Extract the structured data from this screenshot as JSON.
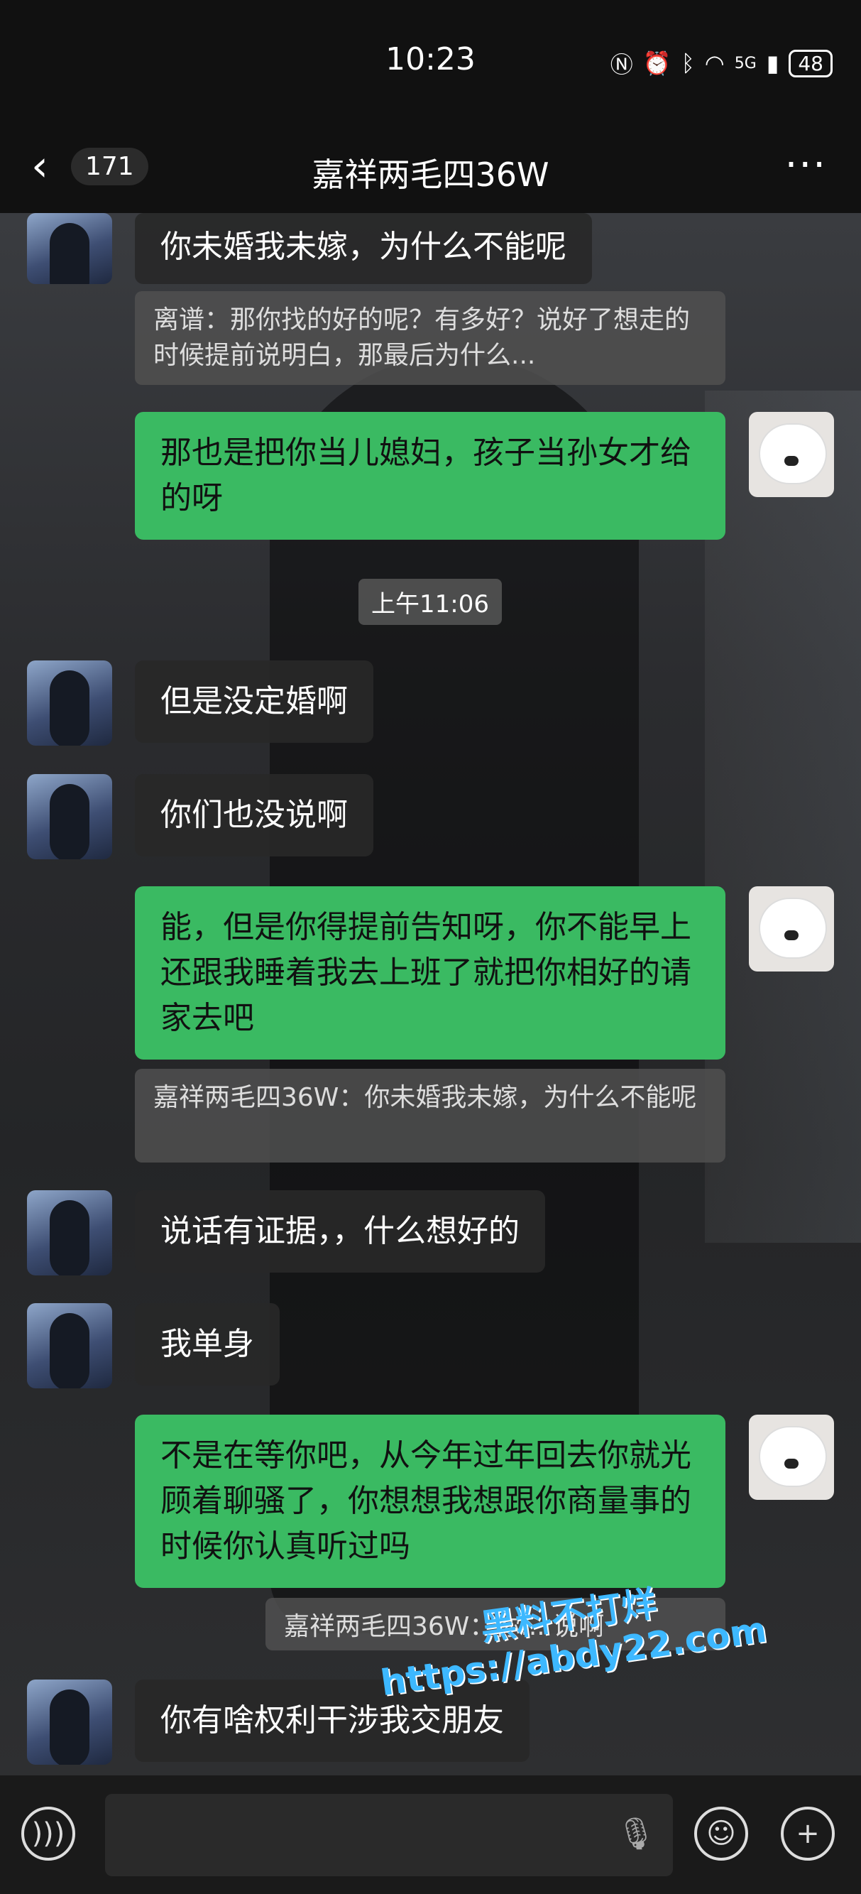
{
  "status": {
    "time": "10:23",
    "network": "5G",
    "battery": "48"
  },
  "header": {
    "back_count": "171",
    "title": "嘉祥两毛四36W"
  },
  "messages": [
    {
      "text": "你未婚我未嫁，为什么不能呢"
    },
    {
      "quote": "离谱：那你找的好的呢？有多好？说好了想走的时候提前说明白，那最后为什么..."
    },
    {
      "text": "那也是把你当儿媳妇，孩子当孙女才给的呀"
    },
    {
      "timestamp": "上午11:06"
    },
    {
      "text": "但是没定婚啊"
    },
    {
      "text": "你们也没说啊"
    },
    {
      "text": "能，但是你得提前告知呀，你不能早上还跟我睡着我去上班了就把你相好的请家去吧"
    },
    {
      "quote": "嘉祥两毛四36W：你未婚我未嫁，为什么不能呢"
    },
    {
      "text": "说话有证据，，什么想好的"
    },
    {
      "text": "我单身"
    },
    {
      "text": "不是在等你吧，从今年过年回去你就光顾着聊骚了，你想想我想跟你商量事的时候你认真听过吗"
    },
    {
      "quote": "嘉祥两毛四36W：你... 说啊"
    },
    {
      "text": "你有啥权利干涉我交朋友"
    }
  ],
  "watermark": {
    "line1": "黑料不打烊",
    "line2": "https://abdy22.com"
  },
  "icons": {
    "back": "chevron-left-icon",
    "more": "more-dots-icon",
    "voice": "voice-icon",
    "mic": "mic-icon",
    "emoji": "emoji-icon",
    "plus": "plus-icon"
  }
}
